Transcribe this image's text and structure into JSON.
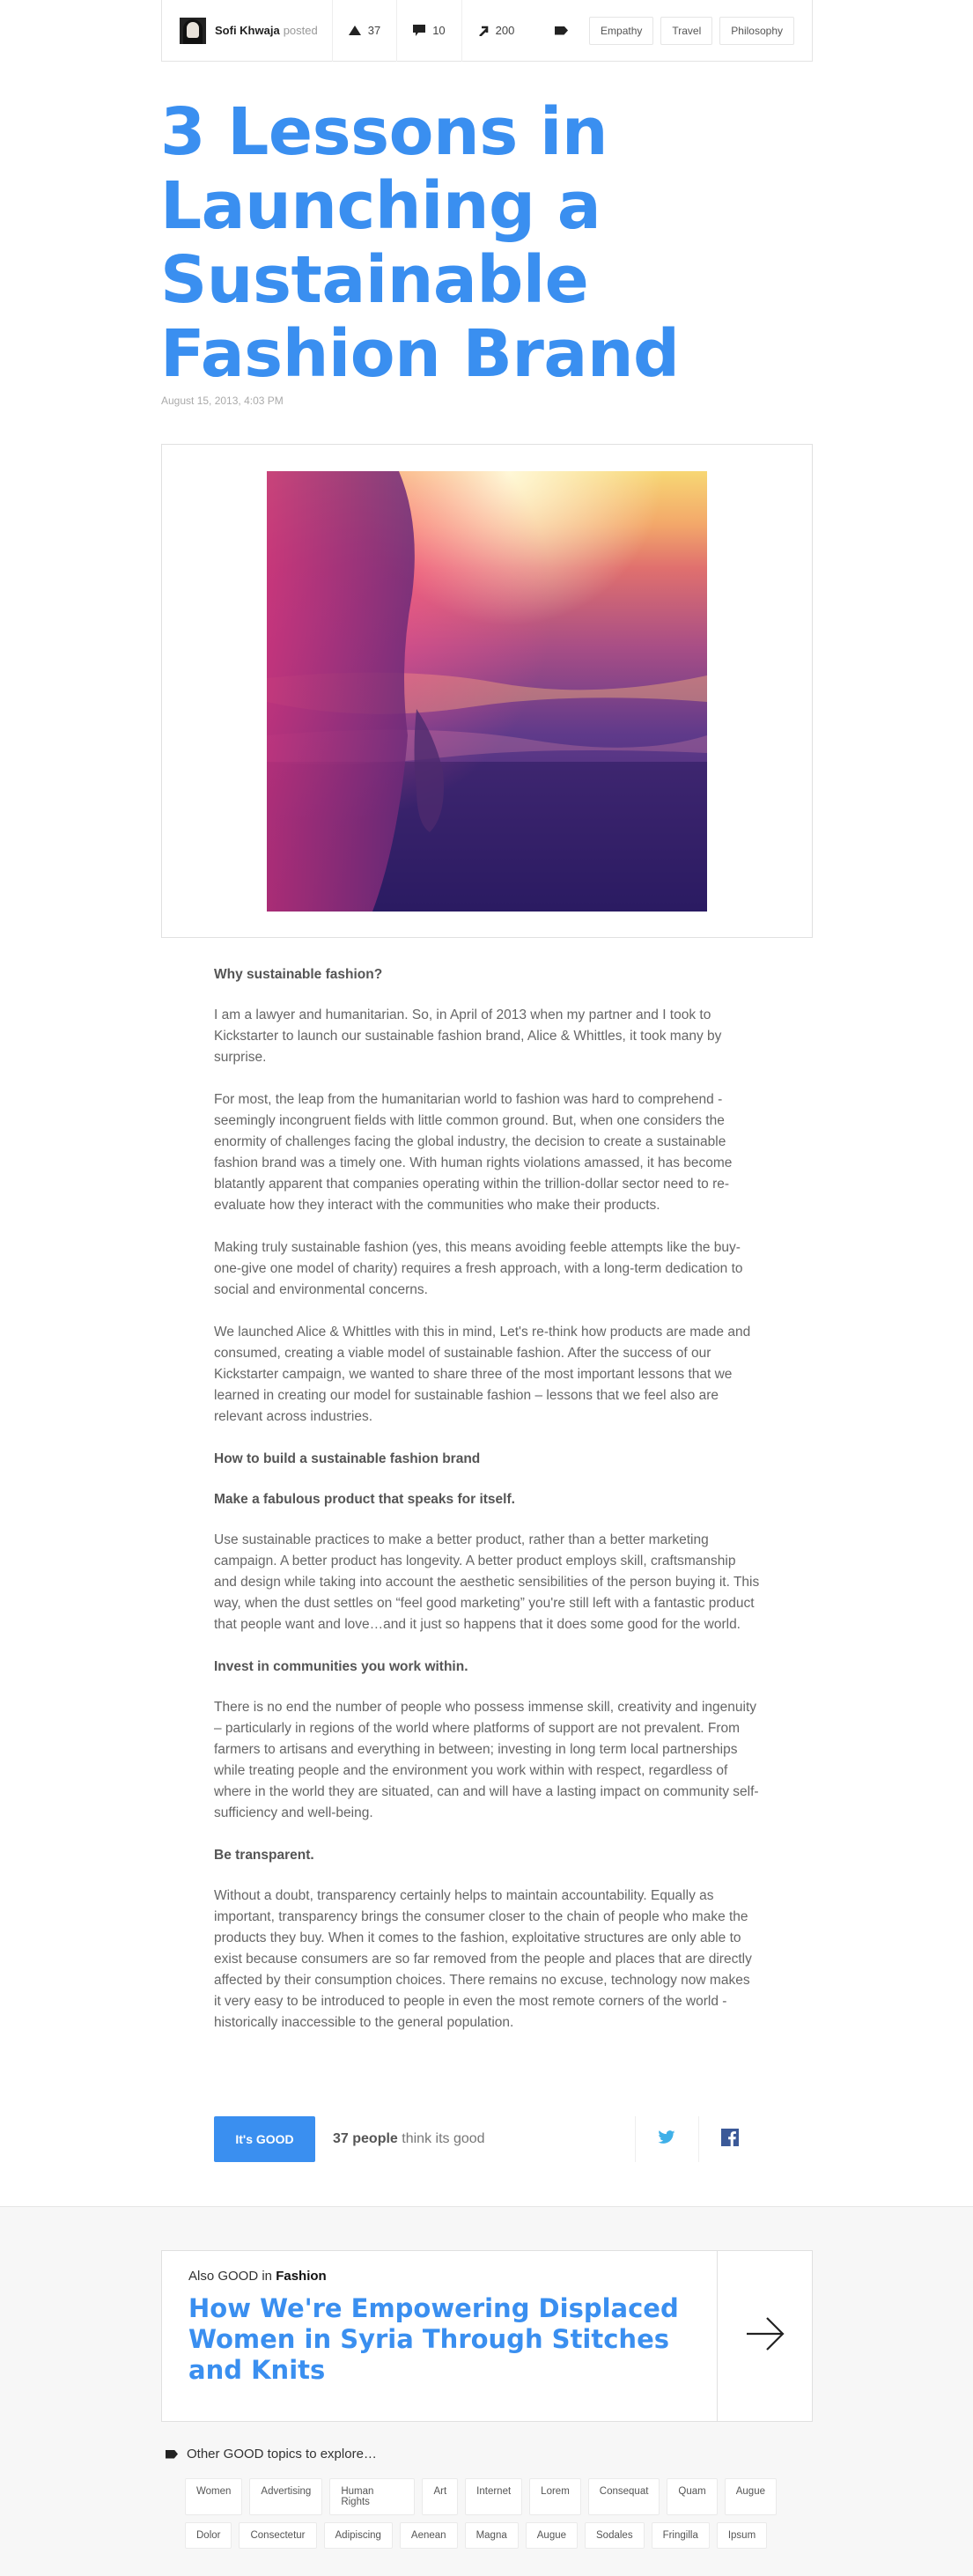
{
  "post": {
    "author": "Sofi Khwaja",
    "posted": "posted",
    "upvotes": "37",
    "comments": "10",
    "shares": "200",
    "tags": [
      "Empathy",
      "Travel",
      "Philosophy"
    ]
  },
  "article": {
    "title": "3 Lessons in Launching a Sustainable Fashion Brand",
    "date": "August 15, 2013, 4:03 PM",
    "blocks": [
      {
        "type": "h",
        "text": "Why sustainable fashion?"
      },
      {
        "type": "p",
        "text": "I am a lawyer and humanitarian. So, in April of 2013 when my partner and I took to Kickstarter to launch our sustainable fashion brand, Alice & Whittles, it took many by surprise."
      },
      {
        "type": "p",
        "text": "For most, the leap from the humanitarian world to fashion was hard to comprehend - seemingly incongruent fields with little common ground. But, when one considers the enormity of challenges facing the global industry, the decision to create a sustainable fashion brand was a timely one. With human rights violations amassed, it has become blatantly apparent that companies operating within the trillion-dollar sector need to re-evaluate how they interact with the communities who make their products."
      },
      {
        "type": "p",
        "text": "Making truly sustainable fashion (yes, this means avoiding feeble attempts like the buy-one-give one model of charity) requires a fresh approach, with a long-term dedication to social and environmental concerns."
      },
      {
        "type": "p",
        "text": "We launched Alice & Whittles with this in mind, Let's re-think how products are made and consumed, creating a viable model of sustainable fashion.  After the success of our Kickstarter campaign, we wanted to share three of the most important lessons that we learned in creating our model for sustainable fashion – lessons that we feel also are relevant across industries."
      },
      {
        "type": "h",
        "text": "How to build a sustainable fashion brand"
      },
      {
        "type": "h",
        "text": "Make a fabulous product that speaks for itself."
      },
      {
        "type": "p",
        "text": "Use sustainable practices to make a better product, rather than a better marketing campaign. A better product has longevity. A better product employs skill, craftsmanship and design while taking into account the aesthetic sensibilities of the person buying it. This way, when the dust settles on “feel good marketing” you're still left with a fantastic product that people want and love…and it just so happens that it does some good for the world."
      },
      {
        "type": "h",
        "text": "Invest in communities you work within."
      },
      {
        "type": "p",
        "text": "There is no end the number of people who possess immense skill, creativity and ingenuity – particularly in regions of the world where platforms of support are not prevalent. From farmers to artisans and everything in between; investing in long term local partnerships while treating people and the environment you work within with respect, regardless of where in the world they are situated, can and will have a lasting impact on community self-sufficiency and well-being."
      },
      {
        "type": "h",
        "text": "Be transparent."
      },
      {
        "type": "p",
        "text": "Without a doubt, transparency certainly helps to maintain accountability. Equally as important, transparency brings the consumer closer to the chain of people who make the products they buy. When it comes to the fashion, exploitative structures are only able to exist because consumers are so far removed from the people and places that are directly affected by their consumption choices. There remains no excuse, technology now makes it very easy to be introduced to people in even the most remote corners of the world - historically inaccessible to the general population."
      }
    ]
  },
  "good": {
    "button": "It's GOOD",
    "count": "37 people",
    "suffix": "think its good"
  },
  "also": {
    "prefix": "Also GOOD in",
    "category": "Fashion",
    "title": "How We're Empowering Displaced Women in Syria Through Stitches and Knits"
  },
  "explore": {
    "label": "Other GOOD topics to explore…",
    "rows": [
      [
        "Women",
        "Advertising",
        "Human Rights",
        "Art",
        "Internet",
        "Lorem",
        "Consequat",
        "Quam",
        "Augue"
      ],
      [
        "Dolor",
        "Consectetur",
        "Adipiscing",
        "Aenean",
        "Magna",
        "Augue",
        "Sodales",
        "Fringilla",
        "Ipsum"
      ]
    ]
  },
  "colors": {
    "accent": "#3a8ff0",
    "footer_bg": "#f7f7f7"
  },
  "icons": [
    "upvote-icon",
    "comment-icon",
    "share-arrow-icon",
    "tag-icon",
    "twitter-icon",
    "facebook-icon",
    "arrow-right-icon"
  ]
}
